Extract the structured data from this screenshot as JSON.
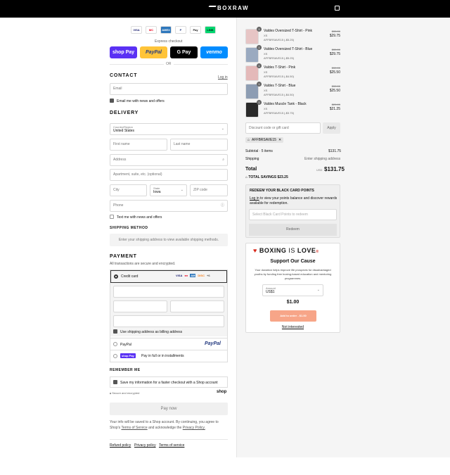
{
  "header": {
    "brand": "BOXRAW"
  },
  "express": {
    "label": "Express checkout",
    "or": "OR",
    "buttons": [
      {
        "label": "shop Pay",
        "bg": "#5a31f4",
        "fg": "#fff"
      },
      {
        "label": "PayPal",
        "bg": "#ffc439",
        "fg": "#253b80"
      },
      {
        "label": "G Pay",
        "bg": "#000",
        "fg": "#fff"
      },
      {
        "label": "venmo",
        "bg": "#008cff",
        "fg": "#fff"
      }
    ],
    "card_icons": [
      "VISA",
      "MC",
      "AMEX",
      "P",
      "Pay",
      "LINK"
    ]
  },
  "contact": {
    "title": "CONTACT",
    "login": "Log in",
    "email_placeholder": "Email",
    "news": "Email me with news and offers"
  },
  "delivery": {
    "title": "DELIVERY",
    "country_label": "Country/Region",
    "country": "United States",
    "first": "First name",
    "last": "Last name",
    "address": "Address",
    "apartment": "Apartment, suite, etc. (optional)",
    "city": "City",
    "state_label": "State",
    "state": "Iowa",
    "zip": "ZIP code",
    "phone": "Phone",
    "text_news": "Text me with news and offers"
  },
  "shipping": {
    "title": "SHIPPING METHOD",
    "note": "Enter your shipping address to view available shipping methods."
  },
  "payment": {
    "title": "PAYMENT",
    "secure": "All transactions are secure and encrypted.",
    "credit": "Credit card",
    "more": "+6",
    "billing": "Use shipping address as billing address",
    "paypal": "PayPal",
    "paypal_logo": "PayPal",
    "shoppay_badge": "shop Pay",
    "shoppay": "Pay in full or in installments"
  },
  "remember": {
    "title": "REMEMBER ME",
    "save": "Save my information for a faster checkout with a Shop account",
    "secure": "Secure and encrypted",
    "shop": "shop"
  },
  "paynow": "Pay now",
  "legal": {
    "line1": "Your info will be saved to a Shop account. By continuing, you agree to",
    "line2a": "Shop's",
    "terms": "Terms of Service",
    "line2b": "and acknowledge the",
    "privacy": "Privacy Policy."
  },
  "footer": {
    "refund": "Refund policy",
    "privacy": "Privacy policy",
    "terms": "Terms of service"
  },
  "items": [
    {
      "name": "Valdes Oversized T-Shirt - Pink",
      "size": "XS",
      "code": "AFFBRSAVE15 (-$5.25)",
      "was": "$35.00",
      "now": "$29.75",
      "qty": "1",
      "color": "#e7c5c5"
    },
    {
      "name": "Valdes Oversized T-Shirt - Blue",
      "size": "XS",
      "code": "AFFBRSAVE15 (-$5.25)",
      "was": "$35.00",
      "now": "$29.75",
      "qty": "1",
      "color": "#9aaac0"
    },
    {
      "name": "Valdes T-Shirt - Pink",
      "size": "XS",
      "code": "AFFBRSAVE15 (-$4.50)",
      "was": "$30.00",
      "now": "$25.50",
      "qty": "1",
      "color": "#e4b9b9"
    },
    {
      "name": "Valdes T-Shirt - Blue",
      "size": "XS",
      "code": "AFFBRSAVE15 (-$4.50)",
      "was": "$30.00",
      "now": "$25.50",
      "qty": "1",
      "color": "#8d9db3"
    },
    {
      "name": "Valdes Muscle Tank - Black",
      "size": "XS",
      "code": "AFFBRSAVE15 (-$3.75)",
      "was": "$25.00",
      "now": "$21.25",
      "qty": "1",
      "color": "#2a2a2a"
    }
  ],
  "discount": {
    "placeholder": "Discount code or gift card",
    "apply": "Apply",
    "tag": "AFFBRSAVE15"
  },
  "summary": {
    "subtotal_label": "Subtotal · 5 items",
    "subtotal": "$131.75",
    "shipping_label": "Shipping",
    "shipping": "Enter shipping address",
    "total_label": "Total",
    "currency": "USD",
    "total": "$131.75",
    "savings_label": "TOTAL SAVINGS",
    "savings": "$23.25"
  },
  "blackcard": {
    "title": "REDEEM YOUR BLACK CARD POINTS",
    "login": "Log in",
    "text1": "to view your points balance and discover rewards",
    "text2": "available for redemption.",
    "select": "Select Black Card Points to redeem",
    "redeem": "Redeem"
  },
  "charity": {
    "logo_a": "BOXING",
    "logo_b": "IS",
    "logo_c": "LOVE",
    "title": "Support Our Cause",
    "text1": "Your donation helps improve life prospects for disadvantaged",
    "text2": "youths by funding free boxing-based education and mentoring",
    "text3": "programmes.",
    "amount_label": "Amount",
    "amount": "US$1",
    "price": "$1.00",
    "add": "Add to order - $1.00",
    "not": "Not interested"
  }
}
